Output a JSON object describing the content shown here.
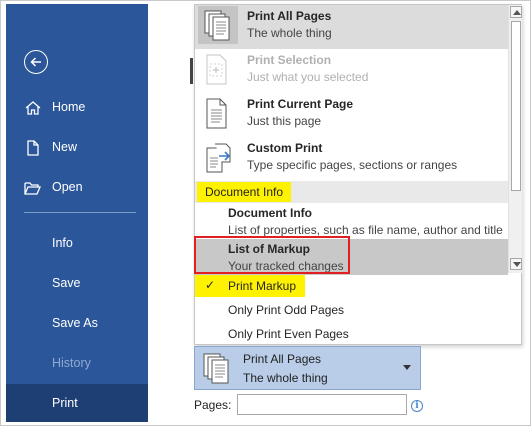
{
  "sidebar": {
    "bg": "#2b579a",
    "active_bg": "#1e3f73",
    "items": [
      {
        "label": "Home",
        "icon": "home-icon"
      },
      {
        "label": "New",
        "icon": "new-document-icon"
      },
      {
        "label": "Open",
        "icon": "open-folder-icon"
      },
      {
        "label": "Info"
      },
      {
        "label": "Save"
      },
      {
        "label": "Save As"
      },
      {
        "label": "History",
        "disabled": true
      },
      {
        "label": "Print",
        "active": true
      }
    ]
  },
  "print_what_menu": {
    "options": [
      {
        "title": "Print All Pages",
        "desc": "The whole thing",
        "icon": "pages-stack-icon",
        "state": "hovered"
      },
      {
        "title": "Print Selection",
        "desc": "Just what you selected",
        "icon": "selection-page-icon",
        "state": "disabled"
      },
      {
        "title": "Print Current Page",
        "desc": "Just this page",
        "icon": "single-page-icon"
      },
      {
        "title": "Custom Print",
        "desc": "Type specific pages, sections or ranges",
        "icon": "custom-print-icon"
      }
    ],
    "section_header": "Document Info",
    "doc_info_items": [
      {
        "title": "Document Info",
        "desc": "List of properties, such as file name, author and title"
      },
      {
        "title": "List of Markup",
        "desc": "Your tracked changes",
        "state": "selected"
      }
    ],
    "toggles": [
      {
        "label": "Print Markup",
        "checked": true
      },
      {
        "label": "Only Print Odd Pages",
        "checked": false
      },
      {
        "label": "Only Print Even Pages",
        "checked": false
      }
    ],
    "highlight_color": "#fff200",
    "annotation_color": "#e02020"
  },
  "selected_setting": {
    "title": "Print All Pages",
    "desc": "The whole thing",
    "icon": "pages-stack-icon",
    "bg": "#b9cde8"
  },
  "pages": {
    "label": "Pages:",
    "value": "",
    "info_icon": "info-icon"
  }
}
